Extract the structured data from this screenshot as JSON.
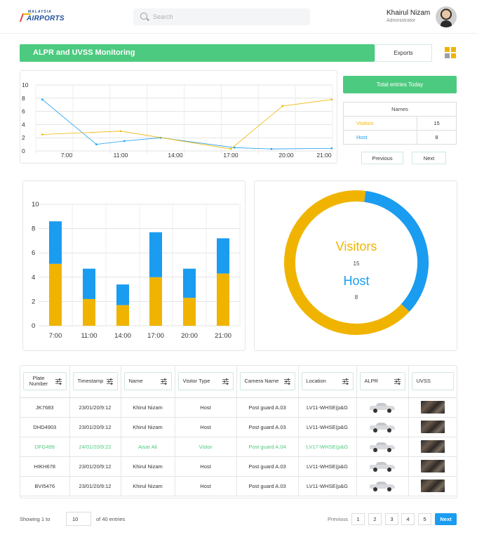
{
  "header": {
    "logo_top": "MALAYSIA",
    "logo_main": "AIRPORTS",
    "search_placeholder": "Search",
    "user_name": "Khairul Nizam",
    "user_role": "Administrator"
  },
  "toolbar": {
    "title": "ALPR and UVSS Monitoring",
    "exports_label": "Exports"
  },
  "colors": {
    "accent_green": "#4cca7f",
    "visitors": "#f0b400",
    "host": "#1a9cf0",
    "next_blue": "#1a9cf0"
  },
  "summary": {
    "total_label": "Total  entries Today",
    "names_header": "Names",
    "rows": [
      {
        "name": "Visitors",
        "value": "15"
      },
      {
        "name": "Host",
        "value": "8"
      }
    ],
    "previous_label": "Previous",
    "next_label": "Next"
  },
  "chart_data": [
    {
      "type": "line",
      "categories": [
        "7:00",
        "11:00",
        "14:00",
        "17:00",
        "20:00",
        "21:00"
      ],
      "ylim": [
        0,
        10
      ],
      "yticks": [
        "0",
        "2",
        "4",
        "6",
        "8",
        "10"
      ],
      "series": [
        {
          "x": [
            5.2,
            7.2,
            9.2,
            11.2,
            13.2,
            15.2,
            17.2,
            19.2,
            21.2
          ],
          "values": [
            7.8,
            null,
            1.0,
            1.5,
            2.0,
            null,
            0.5,
            0.3,
            0.4
          ],
          "color": "#1a9cf0"
        },
        {
          "x": [
            5.2,
            11,
            17,
            19.8,
            21.2
          ],
          "values": [
            2.5,
            3.0,
            0.3,
            6.8,
            7.8
          ],
          "color": "#f0b400"
        }
      ],
      "grid": true
    },
    {
      "type": "bar",
      "stacked": true,
      "categories": [
        "7:00",
        "11:00",
        "14:00",
        "17:00",
        "20:00",
        "21:00"
      ],
      "ylim": [
        0,
        10
      ],
      "yticks": [
        "0",
        "2",
        "4",
        "6",
        "8",
        "10"
      ],
      "series": [
        {
          "color": "#f0b400",
          "values": [
            5.1,
            2.2,
            1.7,
            4.0,
            2.3,
            4.3
          ]
        },
        {
          "color": "#1a9cf0",
          "values": [
            3.5,
            2.5,
            1.7,
            3.7,
            2.4,
            2.9
          ]
        }
      ],
      "grid": true
    },
    {
      "type": "pie",
      "donut": true,
      "labels": [
        "Visitors",
        "Host"
      ],
      "values": [
        15,
        8
      ],
      "colors": [
        "#f0b400",
        "#1a9cf0"
      ]
    }
  ],
  "donut_labels": {
    "visitors_label": "Visitors",
    "visitors_value": "15",
    "host_label": "Host",
    "host_value": "8"
  },
  "table": {
    "columns": [
      "Plate Number",
      "Timestamp",
      "Name",
      "Visitor Type",
      "Camera Name",
      "Location",
      "ALPR",
      "UVSS"
    ],
    "rows": [
      {
        "plate": "JK7683",
        "timestamp": "23/01/20/9:12",
        "name": "Khirul Nizam",
        "type": "Host",
        "camera": "Post guard A.03",
        "location": "LV11-WHSE(p&G",
        "alpr": "car-image-icon",
        "uvss": "undercarriage-image-icon",
        "highlight": false
      },
      {
        "plate": "DHD4903",
        "timestamp": "23/01/20/9:12",
        "name": "Khirul Nizam",
        "type": "Host",
        "camera": "Post guard A.03",
        "location": "LV11-WHSE(p&G",
        "alpr": "car-image-icon",
        "uvss": "undercarriage-image-icon",
        "highlight": false
      },
      {
        "plate": "DFG499",
        "timestamp": "24/01/20/9:22",
        "name": "Aisar Ali",
        "type": "Vistor",
        "camera": "Post guard A.04",
        "location": "LV17-WHSE(p&G",
        "alpr": "car-image-icon",
        "uvss": "undercarriage-image-icon",
        "highlight": true
      },
      {
        "plate": "HIKH678",
        "timestamp": "23/01/20/9:12",
        "name": "Khirul Nizam",
        "type": "Host",
        "camera": "Post guard A.03",
        "location": "LV11-WHSE(p&G",
        "alpr": "car-image-icon",
        "uvss": "undercarriage-image-icon",
        "highlight": false
      },
      {
        "plate": "BVI5476",
        "timestamp": "23/01/20/9:12",
        "name": "Khirul Nizam",
        "type": "Host",
        "camera": "Post guard A.03",
        "location": "LV11-WHSE(p&G",
        "alpr": "car-image-icon",
        "uvss": "undercarriage-image-icon",
        "highlight": false
      }
    ]
  },
  "pagination": {
    "showing_label": "Showing 1 to",
    "page_size": "10",
    "of_entries": "of 40 entries",
    "previous_label": "Previous",
    "pages": [
      "1",
      "2",
      "3",
      "4",
      "5"
    ],
    "next_label": "Next"
  }
}
